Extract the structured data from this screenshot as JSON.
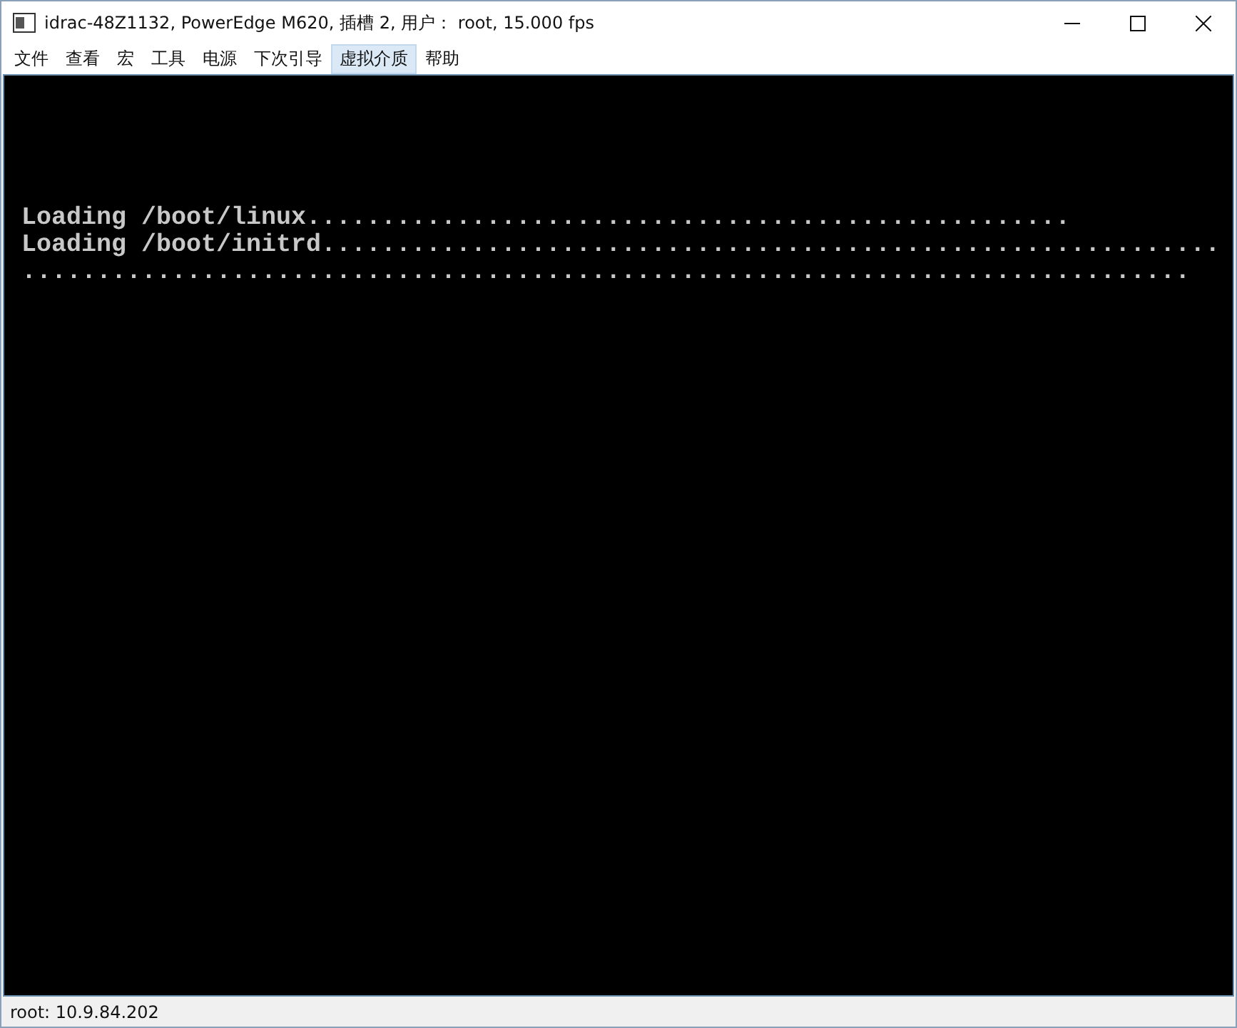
{
  "window": {
    "title": "idrac-48Z1132, PowerEdge M620,  插槽 2, 用户： root, 15.000 fps"
  },
  "menu": [
    {
      "label": "文件",
      "selected": false
    },
    {
      "label": "查看",
      "selected": false
    },
    {
      "label": "宏",
      "selected": false
    },
    {
      "label": "工具",
      "selected": false
    },
    {
      "label": "电源",
      "selected": false
    },
    {
      "label": "下次引导",
      "selected": false
    },
    {
      "label": "虚拟介质",
      "selected": true
    },
    {
      "label": "帮助",
      "selected": false
    }
  ],
  "console": {
    "lines": [
      "Loading /boot/linux...................................................",
      "Loading /boot/initrd............................................................",
      ".............................................................................."
    ]
  },
  "status_bar": "root: 10.9.84.202"
}
